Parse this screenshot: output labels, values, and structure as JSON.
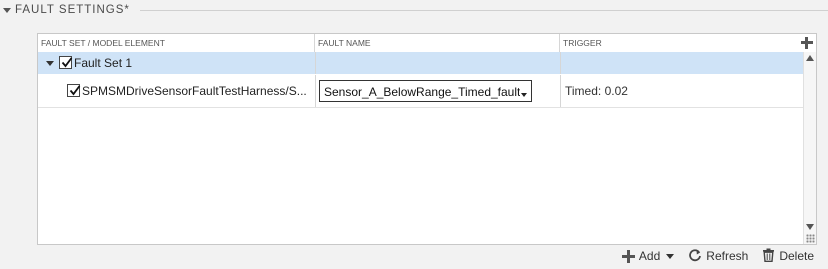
{
  "section": {
    "title": "FAULT SETTINGS*"
  },
  "table": {
    "columns": [
      "FAULT SET / MODEL ELEMENT",
      "FAULT NAME",
      "TRIGGER"
    ],
    "rows": [
      {
        "label": "Fault Set 1",
        "checked": true,
        "fault_name": "",
        "trigger": ""
      },
      {
        "label": "SPMSMDriveSensorFaultTestHarness/S...",
        "checked": true,
        "fault_name": "Sensor_A_BelowRange_Timed_fault",
        "trigger": "Timed: 0.02"
      }
    ]
  },
  "toolbar": {
    "add_label": "Add",
    "refresh_label": "Refresh",
    "delete_label": "Delete"
  },
  "icons": {
    "add": "plus-icon",
    "refresh": "refresh-icon",
    "delete": "trash-icon",
    "add_column": "plus-icon"
  },
  "colors": {
    "selected_row": "#cfe3f7",
    "background": "#f2f2f2"
  }
}
